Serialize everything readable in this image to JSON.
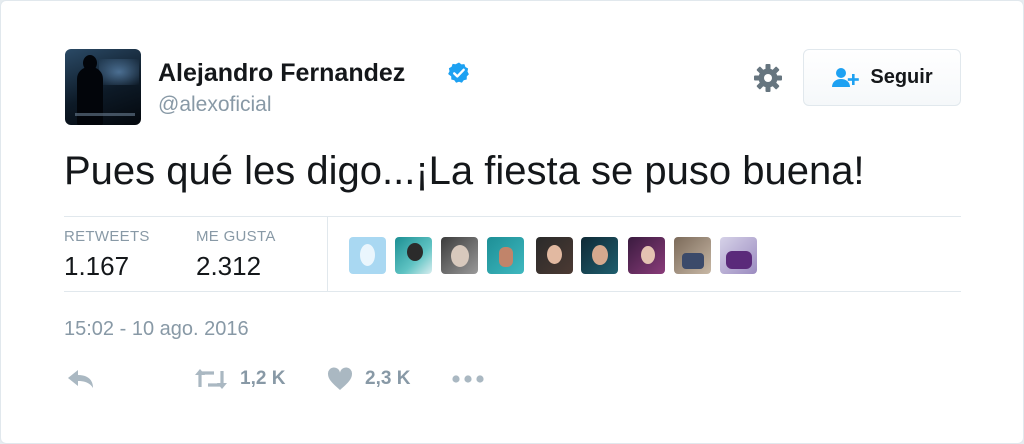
{
  "user": {
    "name": "Alejandro Fernandez",
    "handle": "@alexoficial"
  },
  "follow_button": {
    "label": "Seguir"
  },
  "tweet": {
    "text": "Pues qué les digo...¡La fiesta se puso buena!",
    "timestamp": "15:02 - 10 ago. 2016"
  },
  "stats": {
    "retweets_label": "RETWEETS",
    "retweets_value": "1.167",
    "likes_label": "ME GUSTA",
    "likes_value": "2.312"
  },
  "actions": {
    "retweet_count": "1,2 K",
    "like_count": "2,3 K"
  },
  "colors": {
    "verified": "#1da1f2",
    "icon_gray": "#aab8c2",
    "text_dark": "#14171a",
    "text_muted": "#8899a6"
  }
}
